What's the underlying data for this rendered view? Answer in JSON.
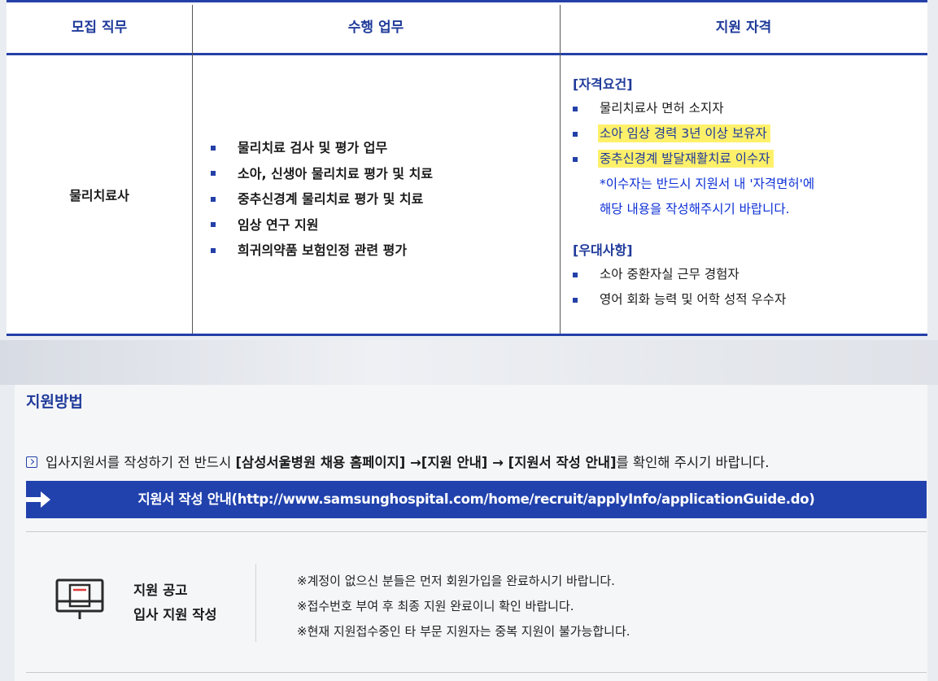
{
  "table": {
    "headers": [
      "모집 직무",
      "수행 업무",
      "지원 자격"
    ],
    "job": "물리치료사",
    "duties": [
      "물리치료 검사 및 평가 업무",
      "소아, 신생아 물리치료 평가 및 치료",
      "중추신경계 물리치료 평가 및 치료",
      "임상 연구 지원",
      "희귀의약품 보험인정 관련 평가"
    ],
    "qualifications": {
      "title": "[자격요건]",
      "items": [
        {
          "text": "물리치료사 면허 소지자",
          "highlight": false
        },
        {
          "text": "소아 임상 경력 3년 이상 보유자",
          "highlight": true
        },
        {
          "text": "중추신경계 발달재활치료 이수자",
          "highlight": true
        }
      ],
      "note_line1": "*이수자는 반드시 지원서 내 '자격면허'에",
      "note_line2": "해당 내용을 작성해주시기 바랍니다."
    },
    "preferences": {
      "title": "[우대사항]",
      "items": [
        "소아 중환자실 근무 경험자",
        "영어 회화 능력 및 어학 성적 우수자"
      ]
    }
  },
  "apply": {
    "title": "지원방법",
    "desc_before": "입사지원서를 작성하기 전 반드시 ",
    "desc_bold1": "[삼성서울병원 채용 홈페이지] →[지원 안내] → [지원서 작성 안내]",
    "desc_after": "를 확인해 주시기 바랍니다.",
    "guide_label": "지원서 작성 안내(http://www.samsunghospital.com/home/recruit/applyInfo/applicationGuide.do)",
    "step_line1": "지원 공고",
    "step_line2": "입사 지원 작성",
    "notes": [
      "※계정이 없으신 분들은 먼저 회원가입을 완료하시기 바랍니다.",
      "※접수번호 부여 후 최종 지원 완료이니 확인 바랍니다.",
      "※현재 지원접수중인 타 부문 지원자는 중복 지원이 불가능합니다."
    ]
  },
  "colors": {
    "accent": "#2440a8",
    "highlight": "#fff06a",
    "note_blue": "#0c2fd6"
  },
  "icons": {
    "guide": "arrow-right-icon",
    "step": "monitor-icon",
    "desc": "chevron-box-icon"
  }
}
